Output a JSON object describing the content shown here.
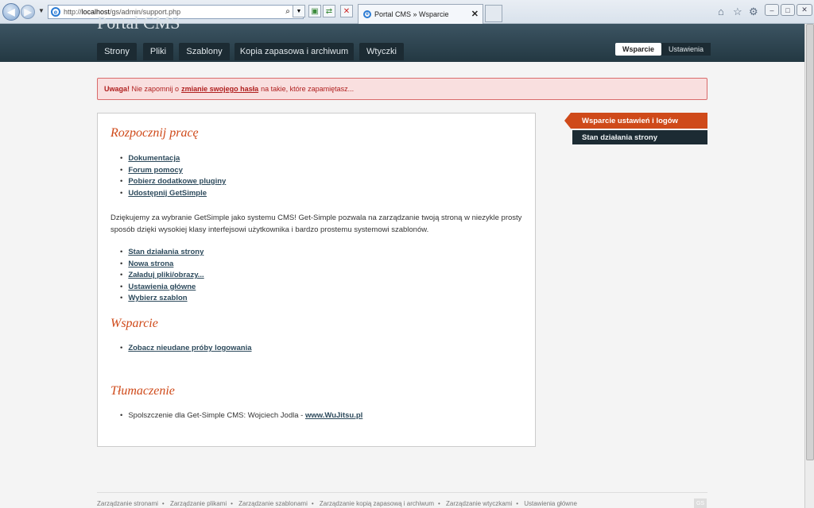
{
  "browser": {
    "url_prefix": "http://",
    "url_host": "localhost",
    "url_path": "/gs/admin/support.php",
    "tab_title": "Portal CMS » Wsparcie"
  },
  "header": {
    "site_title": "Portal CMS",
    "tabs": [
      "Strony",
      "Pliki",
      "Szablony",
      "Kopia zapasowa i archiwum",
      "Wtyczki"
    ],
    "right_tabs": [
      "Wsparcie",
      "Ustawienia"
    ]
  },
  "alert": {
    "label": "Uwaga!",
    "text_before": "Nie zapomnij o",
    "link": "zmianie swojego hasła",
    "text_after": "na takie, które zapamiętasz..."
  },
  "main": {
    "section1_title": "Rozpocznij pracę",
    "links1": [
      "Dokumentacja",
      "Forum pomocy",
      "Pobierz dodatkowe pluginy",
      "Udostępnij GetSimple"
    ],
    "intro": "Dziękujemy za wybranie GetSimple jako systemu CMS! Get-Simple pozwala na zarządzanie twoją stroną w niezykle prosty sposób dzięki wysokiej klasy interfejsowi użytkownika i bardzo prostemu systemowi szablonów.",
    "links2": [
      "Stan działania strony",
      "Nowa strona",
      "Załaduj pliki/obrazy...",
      "Ustawienia główne",
      "Wybierz szablon"
    ],
    "section2_title": "Wsparcie",
    "links3": [
      "Zobacz nieudane próby logowania"
    ],
    "section3_title": "Tłumaczenie",
    "translation_text": "Spolszczenie dla Get-Simple CMS: Wojciech Jodla -",
    "translation_link": "www.WuJitsu.pl"
  },
  "sidebar": {
    "active": "Wsparcie ustawień i logów",
    "item": "Stan działania strony"
  },
  "footer": {
    "links": [
      "Zarządzanie stronami",
      "Zarządzanie plikami",
      "Zarządzanie szablonami",
      "Zarządzanie kopią zapasową i archiwum",
      "Zarządzanie wtyczkami",
      "Ustawienia główne"
    ],
    "logo": "GS"
  }
}
